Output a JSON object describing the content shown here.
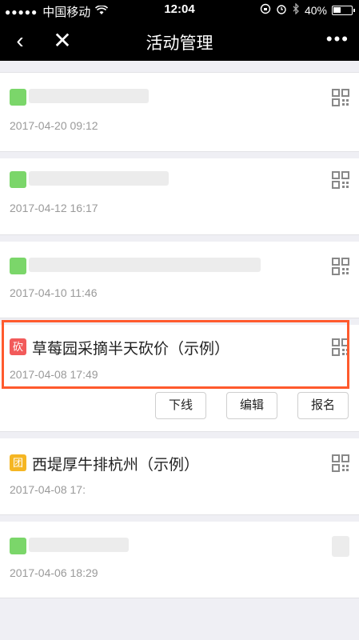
{
  "status": {
    "dots": "●●●●●",
    "carrier": "中国移动",
    "time": "12:04",
    "battery": "40%"
  },
  "nav": {
    "back": "‹",
    "close": "✕",
    "title": "活动管理",
    "more": "•••"
  },
  "items": [
    {
      "badge": "",
      "title": "",
      "date": "2017-04-20 09:12"
    },
    {
      "badge": "",
      "title": "",
      "date": "2017-04-12 16:17"
    },
    {
      "badge": "",
      "title": "",
      "date": "2017-04-10 11:46"
    },
    {
      "badge": "砍",
      "title": "草莓园采摘半天砍价（示例）",
      "date": "2017-04-08 17:49",
      "actions": [
        "下线",
        "编辑",
        "报名"
      ]
    },
    {
      "badge": "团",
      "title": "西堤厚牛排杭州（示例）",
      "date": "2017-04-08 17:"
    },
    {
      "badge": "",
      "title": "",
      "date": "2017-04-06 18:29"
    }
  ],
  "colors": {
    "bargain_badge": "#f25a5a",
    "group_badge": "#f5b623",
    "blurred_badge": "#7bd66a",
    "highlight": "#ff5a2d"
  }
}
